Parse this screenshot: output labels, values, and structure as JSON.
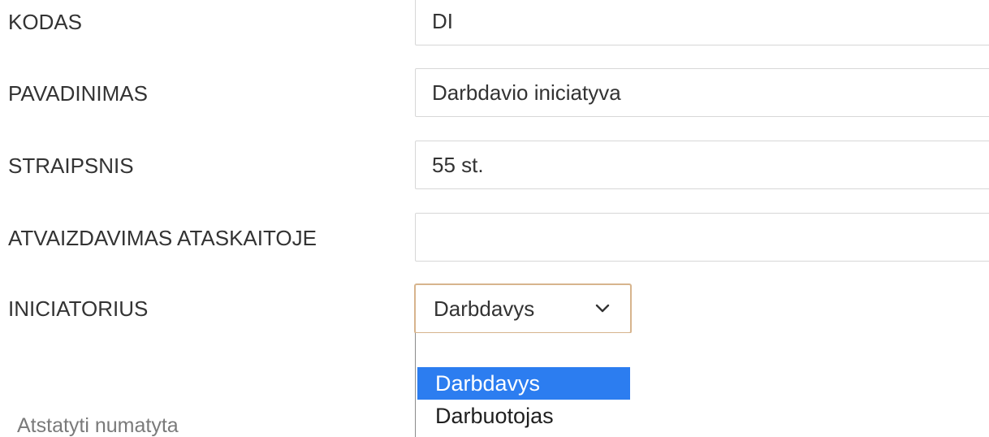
{
  "form": {
    "kodas": {
      "label": "KODAS",
      "value": "DI"
    },
    "pavadinimas": {
      "label": "PAVADINIMAS",
      "value": "Darbdavio iniciatyva"
    },
    "straipsnis": {
      "label": "STRAIPSNIS",
      "value": "55 st."
    },
    "atvaizdavimas": {
      "label": "ATVAIZDAVIMAS ATASKAITOJE",
      "value": ""
    },
    "iniciatorius": {
      "label": "INICIATORIUS",
      "value": "Darbdavys",
      "options": [
        "",
        "Darbdavys",
        "Darbuotojas"
      ],
      "highlighted": "Darbdavys"
    }
  },
  "footer": {
    "reset_link": "Atstatyti numatyta"
  },
  "colors": {
    "select_border": "#d7b48d",
    "option_highlight": "#2c7df0"
  },
  "icons": {
    "select_chevron": "chevron-down-icon"
  }
}
